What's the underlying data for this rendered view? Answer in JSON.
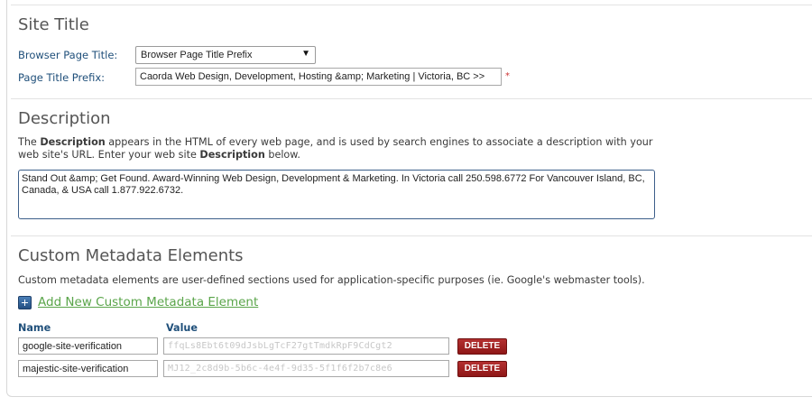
{
  "site_title": {
    "heading": "Site Title",
    "browser_page_title_label": "Browser Page Title:",
    "browser_page_title_value": "Browser Page Title Prefix",
    "page_title_prefix_label": "Page Title Prefix:",
    "page_title_prefix_value": "Caorda Web Design, Development, Hosting &amp; Marketing | Victoria, BC >>",
    "required_mark": "*"
  },
  "description": {
    "heading": "Description",
    "intro_1": "The ",
    "intro_bold_1": "Description",
    "intro_2": " appears in the HTML of every web page, and is used by search engines to associate a description with your web site's URL. Enter your web site ",
    "intro_bold_2": "Description",
    "intro_3": " below.",
    "value": "Stand Out &amp; Get Found. Award-Winning Web Design, Development & Marketing. In Victoria call 250.598.6772 For Vancouver Island, BC, Canada, & USA call 1.877.922.6732."
  },
  "custom_metadata": {
    "heading": "Custom Metadata Elements",
    "intro": "Custom metadata elements are user-defined sections used for application-specific purposes (ie. Google's webmaster tools).",
    "add_link": "Add New Custom Metadata Element",
    "name_header": "Name",
    "value_header": "Value",
    "rows": [
      {
        "name": "google-site-verification",
        "value": "ffqLs8Ebt6t09dJsbLgTcF27gtTmdkRpF9CdCgt2",
        "delete": "DELETE"
      },
      {
        "name": "majestic-site-verification",
        "value": "MJ12_2c8d9b-5b6c-4e4f-9d35-5f1f6f2b7c8e6",
        "delete": "DELETE"
      }
    ]
  }
}
